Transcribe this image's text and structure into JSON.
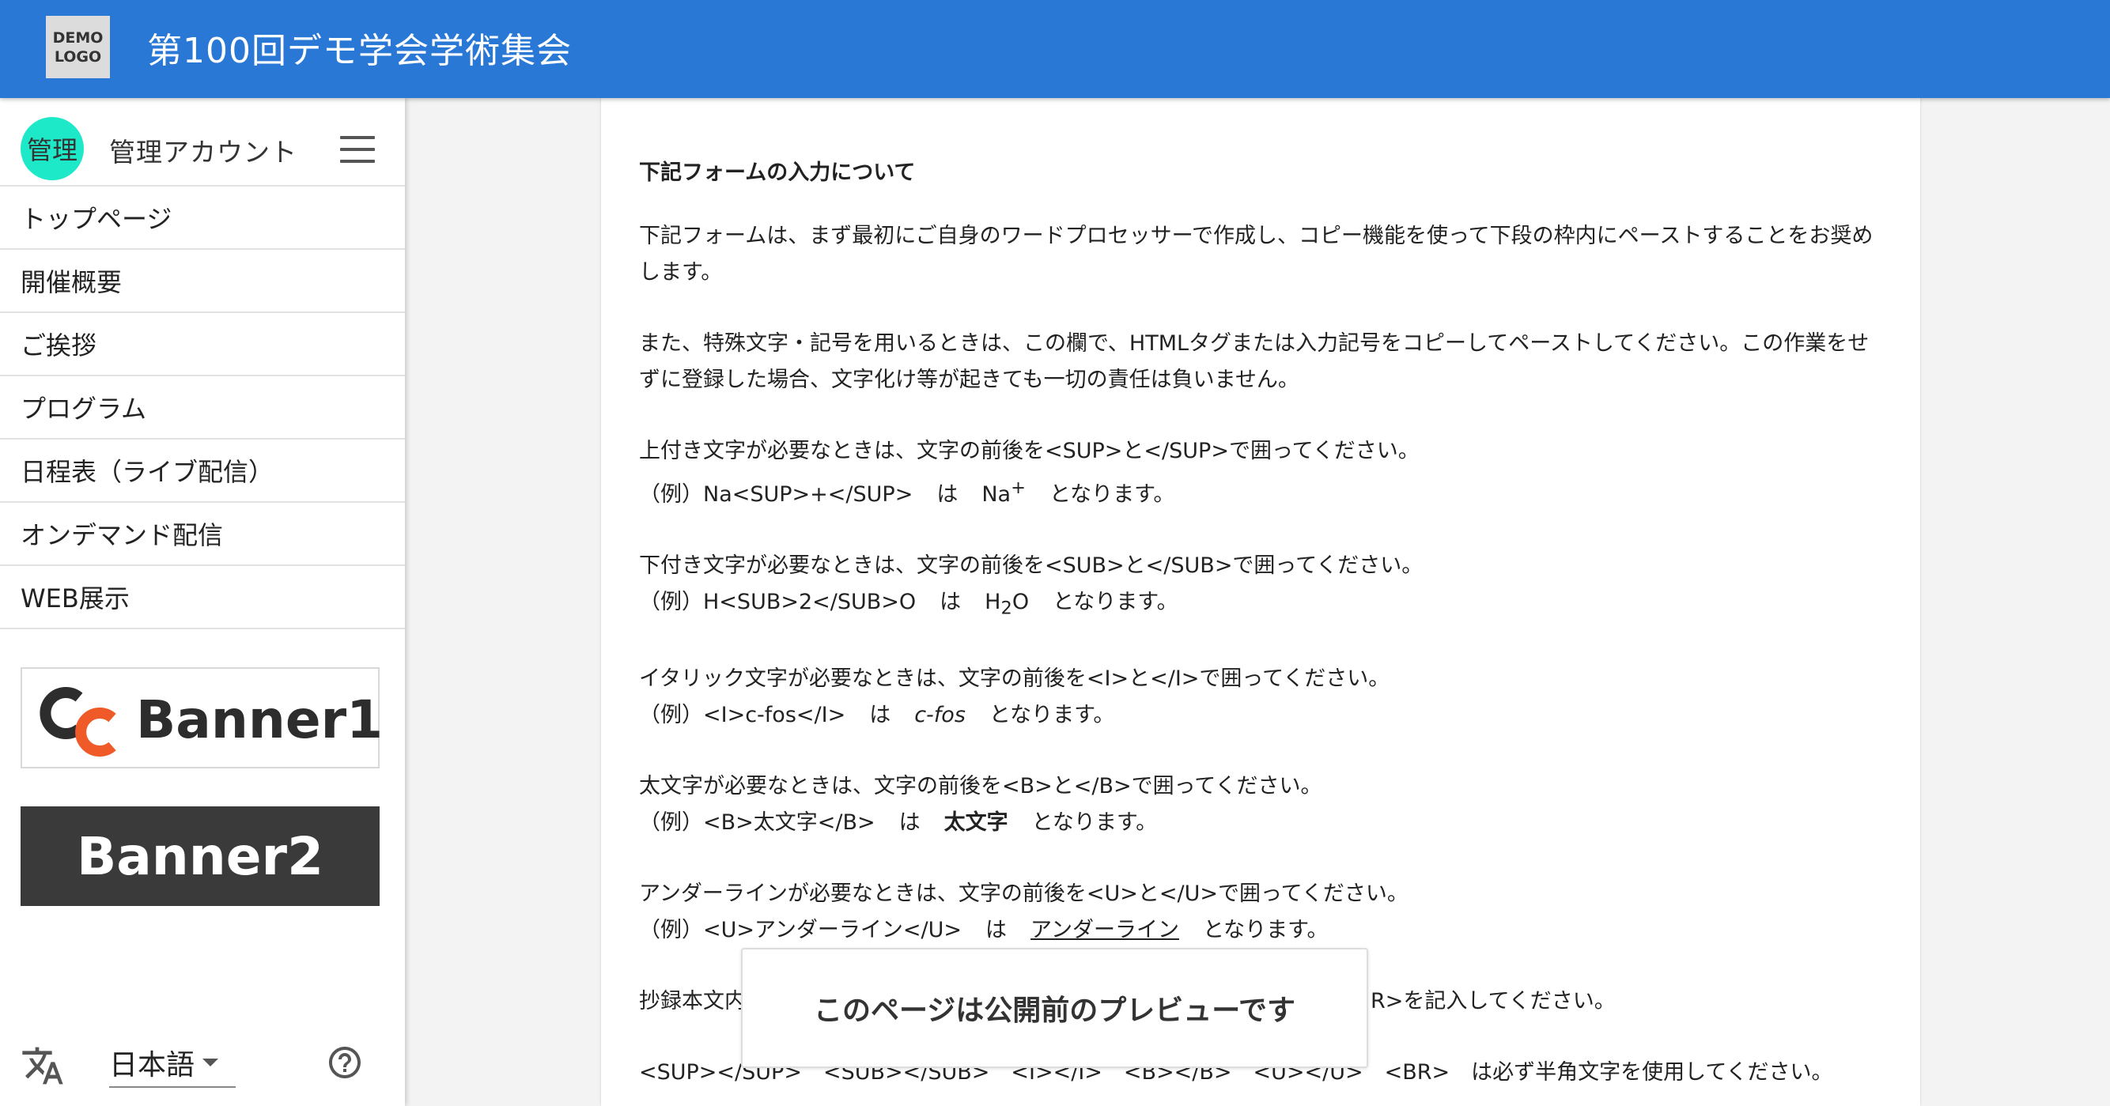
{
  "header": {
    "logo_line1": "DEMO",
    "logo_line2": "LOGO",
    "title": "第100回デモ学会学術集会",
    "color": "#2a78d6"
  },
  "sidebar": {
    "account": {
      "avatar_text": "管理",
      "name": "管理アカウント",
      "avatar_color": "#1de9c8"
    },
    "menu_icon": "hamburger-menu-icon",
    "items": [
      {
        "label": "トップページ"
      },
      {
        "label": "開催概要"
      },
      {
        "label": "ご挨拶"
      },
      {
        "label": "プログラム"
      },
      {
        "label": "日程表（ライブ配信）"
      },
      {
        "label": "オンデマンド配信"
      },
      {
        "label": "WEB展示"
      }
    ],
    "banners": [
      {
        "label": "Banner1"
      },
      {
        "label": "Banner2"
      }
    ],
    "language": {
      "selected": "日本語",
      "icon": "translate-icon"
    },
    "help_icon": "help-circle-icon"
  },
  "content": {
    "heading": "下記フォームの入力について",
    "p1": "下記フォームは、まず最初にご自身のワードプロセッサーで作成し、コピー機能を使って下段の枠内にペーストすることをお奨めします。",
    "p2": "また、特殊文字・記号を用いるときは、この欄で、HTMLタグまたは入力記号をコピーしてペーストしてください。この作業をせずに登録した場合、文字化け等が起きても一切の責任は負いません。",
    "sup": {
      "rule": "上付き文字が必要なときは、文字の前後を<SUP>と</SUP>で囲ってください。",
      "example_prefix": "（例）Na<SUP>+</SUP>",
      "wa": "は",
      "result_base": "Na",
      "result_sup": "+",
      "suffix": "となります。"
    },
    "sub": {
      "rule": "下付き文字が必要なときは、文字の前後を<SUB>と</SUB>で囲ってください。",
      "example_prefix": "（例）H<SUB>2</SUB>O",
      "wa": "は",
      "result_base": "H",
      "result_sub": "2",
      "result_tail": "O",
      "suffix": "となります。"
    },
    "italic": {
      "rule": "イタリック文字が必要なときは、文字の前後を<I>と</I>で囲ってください。",
      "example_prefix": "（例）<I>c-fos</I>",
      "wa": "は",
      "result": "c-fos",
      "suffix": "となります。"
    },
    "bold": {
      "rule": "太文字が必要なときは、文字の前後を<B>と</B>で囲ってください。",
      "example_prefix": "（例）<B>太文字</B>",
      "wa": "は",
      "result": "太文字",
      "suffix": "となります。"
    },
    "underline": {
      "rule": "アンダーラインが必要なときは、文字の前後を<U>と</U>で囲ってください。",
      "example_prefix": "（例）<U>アンダーライン</U>",
      "wa": "は",
      "result": "アンダーライン",
      "suffix": "となります。"
    },
    "br_left": "抄録本文内",
    "br_right": "R>を記入してください。",
    "final_line": "<SUP></SUP>　<SUB></SUB>　<I></I>　<B></B>　<U></U>　<BR>　は必ず半角文字を使用してください。"
  },
  "toast": {
    "text": "このページは公開前のプレビューです"
  }
}
